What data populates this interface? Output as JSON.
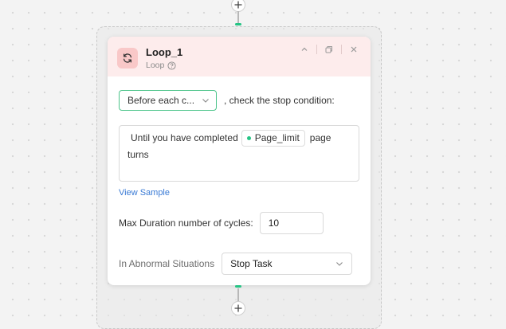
{
  "node": {
    "title": "Loop_1",
    "type_label": "Loop",
    "header_icon": "loop-icon",
    "accent_color": "#26c485",
    "header_bg": "#fdecec"
  },
  "condition": {
    "timing_select": "Before each c...",
    "timing_suffix": ", check the stop condition:",
    "text_before": "Until you have completed",
    "param_tag": "Page_limit",
    "text_after": "page",
    "text_wrap": "turns",
    "view_sample": "View Sample"
  },
  "max_duration": {
    "label": "Max Duration number of cycles:",
    "value": "10"
  },
  "abnormal": {
    "label": "In Abnormal Situations",
    "selected": "Stop Task"
  },
  "icons": {
    "collapse": "chevron-up-icon",
    "copy": "copy-icon",
    "close": "close-icon",
    "help": "help-icon",
    "dropdown": "chevron-down-icon",
    "add": "plus-icon"
  }
}
